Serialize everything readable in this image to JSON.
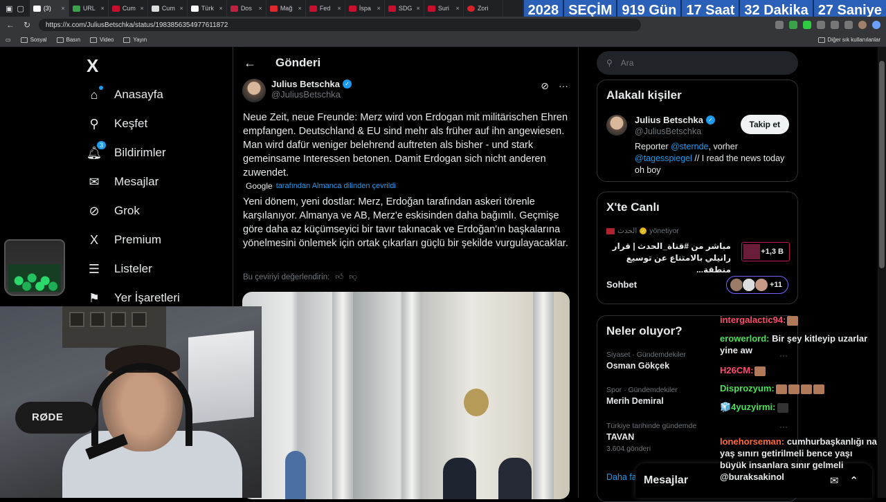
{
  "browser": {
    "tabs": [
      "(3)",
      "URL",
      "Cum",
      "Cum",
      "Türk",
      "Dos",
      "Mağ",
      "Fed",
      "İspa",
      "SDG",
      "Suri",
      "Zori"
    ],
    "url": "https://x.com/JuliusBetschka/status/1983856354977611872",
    "bookmarks": [
      "Sosyal",
      "Basın",
      "Video",
      "Yayın"
    ],
    "other_bookmarks": "Diğer sık kullanılanlar",
    "nav_back": "←",
    "nav_reload": "↻",
    "close_glyph": "×"
  },
  "countdown": [
    "2028",
    "SEÇİM",
    "919 Gün",
    "17 Saat",
    "32 Dakika",
    "27 Saniye"
  ],
  "leftnav": {
    "logo": "X",
    "items": [
      {
        "label": "Anasayfa",
        "icon": "⌂"
      },
      {
        "label": "Keşfet",
        "icon": "⚲"
      },
      {
        "label": "Bildirimler",
        "icon": "🔔︎",
        "badge": "3"
      },
      {
        "label": "Mesajlar",
        "icon": "✉"
      },
      {
        "label": "Grok",
        "icon": "⊘"
      },
      {
        "label": "Premium",
        "icon": "X"
      },
      {
        "label": "Listeler",
        "icon": "☰"
      },
      {
        "label": "Yer İşaretleri",
        "icon": "⚑"
      }
    ]
  },
  "post": {
    "header": "Gönderi",
    "back_glyph": "←",
    "author_name": "Julius Betschka",
    "author_handle": "@JuliusBetschka",
    "text": "Neue Zeit, neue Freunde: Merz wird von Erdogan mit militärischen Ehren empfangen. Deutschland & EU sind mehr als früher auf ihn angewiesen. Man wird dafür weniger belehrend auftreten als bisher - und stark gemeinsame Interessen betonen. Damit Erdogan sich nicht anderen zuwendet.",
    "translated_by": "Google",
    "translated_label": "tarafından Almanca dilinden çevrildi",
    "translation": "Yeni dönem, yeni dostlar: Merz, Erdoğan tarafından askeri törenle karşılanıyor. Almanya ve AB, Merz'e eskisinden daha bağımlı. Geçmişe göre daha az küçümseyici bir tavır takınacak ve Erdoğan'ın başkalarına yönelmesini önlemek için ortak çıkarları güçlü bir şekilde vurgulayacaklar.",
    "rate_prompt": "Bu çeviriyi değerlendirin:",
    "thumbs_up": "👍︎",
    "thumbs_down": "👎︎",
    "grok_glyph": "⊘",
    "more_glyph": "···"
  },
  "right": {
    "search_placeholder": "Ara",
    "search_glyph": "⚲",
    "people_title": "Alakalı kişiler",
    "person_name": "Julius Betschka",
    "person_handle": "@JuliusBetschka",
    "follow_label": "Takip et",
    "bio_1": "Reporter ",
    "bio_link1": "@sternde",
    "bio_2": ", vorher ",
    "bio_link2": "@tagesspiegel",
    "bio_3": " // I read the news today oh boy",
    "live_title": "X'te Canlı",
    "live_channel": "الحدث",
    "live_status": "yönetiyor",
    "live_text": "مباشر من #قناة_الحدث | قرار رانيلي بالامتناع عن توسيع منطقة...",
    "live_count": "+1,3 B",
    "sohbet": "Sohbet",
    "sohbet_count": "+11",
    "trends_title": "Neler oluyor?",
    "trends": [
      {
        "category": "Siyaset · Gündemdekiler",
        "name": "Osman Gökçek",
        "count": ""
      },
      {
        "category": "Spor · Gündemdekiler",
        "name": "Merih Demiral",
        "count": ""
      },
      {
        "category": "Türkiye tarihinde gündemde",
        "name": "TAVAN",
        "count": "3.604 gönderi"
      }
    ],
    "show_more": "Daha fa",
    "dm_title": "Mesajlar",
    "dm_icon_new": "✉",
    "dm_icon_expand": "⌃"
  },
  "webcam": {
    "mic_brand": "RØDE"
  },
  "chat": [
    {
      "user": "intergalactic94:",
      "text": "",
      "color": "#ff4b6e"
    },
    {
      "user": "erowerlord:",
      "text": "Bir şey kitleyip uzarlar yine aw",
      "color": "#4fe05a"
    },
    {
      "user": "H26CM:",
      "text": "",
      "color": "#ff4b6e"
    },
    {
      "user": "Disprozyum:",
      "text": "",
      "color": "#4fe05a"
    },
    {
      "user": "🧊4yuzyirmi:",
      "text": "",
      "color": "#4fe05a"
    },
    {
      "user": "lonehorseman:",
      "text": "cumhurbaşkanlığı na yaş sınırı getirilmeli bence yaşı büyük insanlara sınır gelmeli @buraksakinol",
      "color": "#ff6a3c"
    }
  ]
}
